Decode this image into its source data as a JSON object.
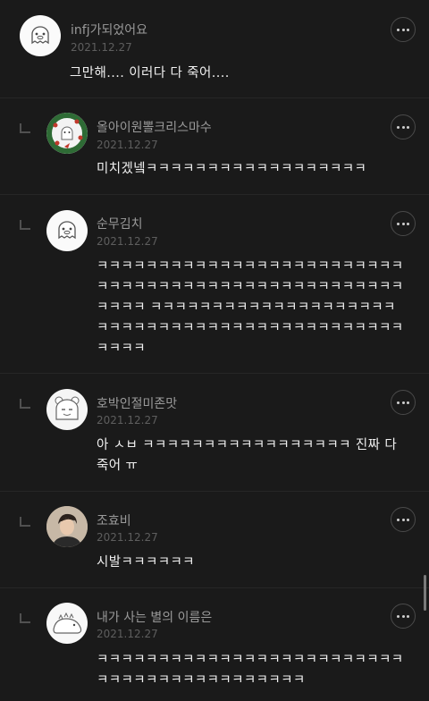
{
  "comments": [
    {
      "name": "infj가되었어요",
      "date": "2021.12.27",
      "text": "그만해.... 이러다 다 죽어....",
      "avatar": "ghost-avatar-icon"
    },
    {
      "name": "올아이원뽈크리스마수",
      "date": "2021.12.27",
      "text": "미치겠넼ㅋㅋㅋㅋㅋㅋㅋㅋㅋㅋㅋㅋㅋㅋㅋㅋㅋㅋ",
      "avatar": "christmas-wreath-avatar"
    },
    {
      "name": "순무김치",
      "date": "2021.12.27",
      "text": "ㅋㅋㅋㅋㅋㅋㅋㅋㅋㅋㅋㅋㅋㅋㅋㅋㅋㅋㅋㅋㅋㅋㅋㅋㅋㅋㅋㅋㅋㅋㅋㅋㅋㅋㅋㅋㅋㅋㅋㅋㅋㅋㅋㅋㅋㅋㅋㅋㅋㅋㅋㅋㅋㅋ ㅋㅋㅋㅋㅋㅋㅋㅋㅋㅋㅋㅋㅋㅋㅋㅋㅋㅋㅋㅋㅋㅋㅋㅋㅋㅋㅋㅋㅋㅋㅋㅋㅋㅋㅋㅋㅋㅋㅋㅋㅋㅋㅋㅋㅋㅋㅋㅋㅋ",
      "avatar": "ghost-avatar-icon"
    },
    {
      "name": "호박인절미존맛",
      "date": "2021.12.27",
      "text": "아 ㅅㅂ ㅋㅋㅋㅋㅋㅋㅋㅋㅋㅋㅋㅋㅋㅋㅋㅋㅋ 진짜 다 죽어 ㅠ",
      "avatar": "bear-avatar-icon"
    },
    {
      "name": "조효비",
      "date": "2021.12.27",
      "text": "시발ㅋㅋㅋㅋㅋㅋ",
      "avatar": "person-photo-avatar"
    },
    {
      "name": "내가 사는 별의 이름은",
      "date": "2021.12.27",
      "text": "ㅋㅋㅋㅋㅋㅋㅋㅋㅋㅋㅋㅋㅋㅋㅋㅋㅋㅋㅋㅋㅋㅋㅋㅋㅋㅋㅋㅋㅋㅋㅋㅋㅋㅋㅋㅋㅋㅋㅋㅋㅋㅋ",
      "avatar": "dinosaur-avatar-icon"
    }
  ]
}
